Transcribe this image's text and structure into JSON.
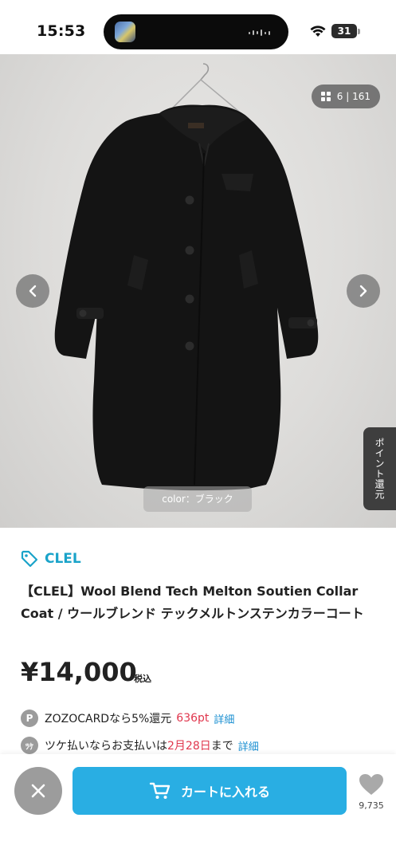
{
  "status_bar": {
    "time": "15:53",
    "battery": "31"
  },
  "gallery": {
    "counter": "6 | 161",
    "color_label": "color：ブラック",
    "points_tab": "ポイント還元",
    "icons": {
      "prev": "chevron-left-icon",
      "next": "chevron-right-icon",
      "grid": "grid-icon"
    }
  },
  "product": {
    "brand": "CLEL",
    "title": "【CLEL】Wool Blend Tech Melton Soutien Collar Coat / ウールブレンド テックメルトンステンカラーコート",
    "price": "¥14,000",
    "tax_label": "税込"
  },
  "zozocard": {
    "badge": "P",
    "text": "ZOZOCARDなら5%還元",
    "points": "636pt",
    "detail": "詳細"
  },
  "tsuke": {
    "badge": "ﾂｹ",
    "text_before": "ツケ払いならお支払いは",
    "date": "2月28日",
    "text_after": "まで",
    "detail": "詳細"
  },
  "bottom_bar": {
    "cart_label": "カートに入れる",
    "favorite_count": "9,735"
  },
  "colors": {
    "accent": "#29aee3",
    "brand": "#1aa3c9",
    "sale_red": "#e0364d",
    "link": "#1a8fd1"
  }
}
